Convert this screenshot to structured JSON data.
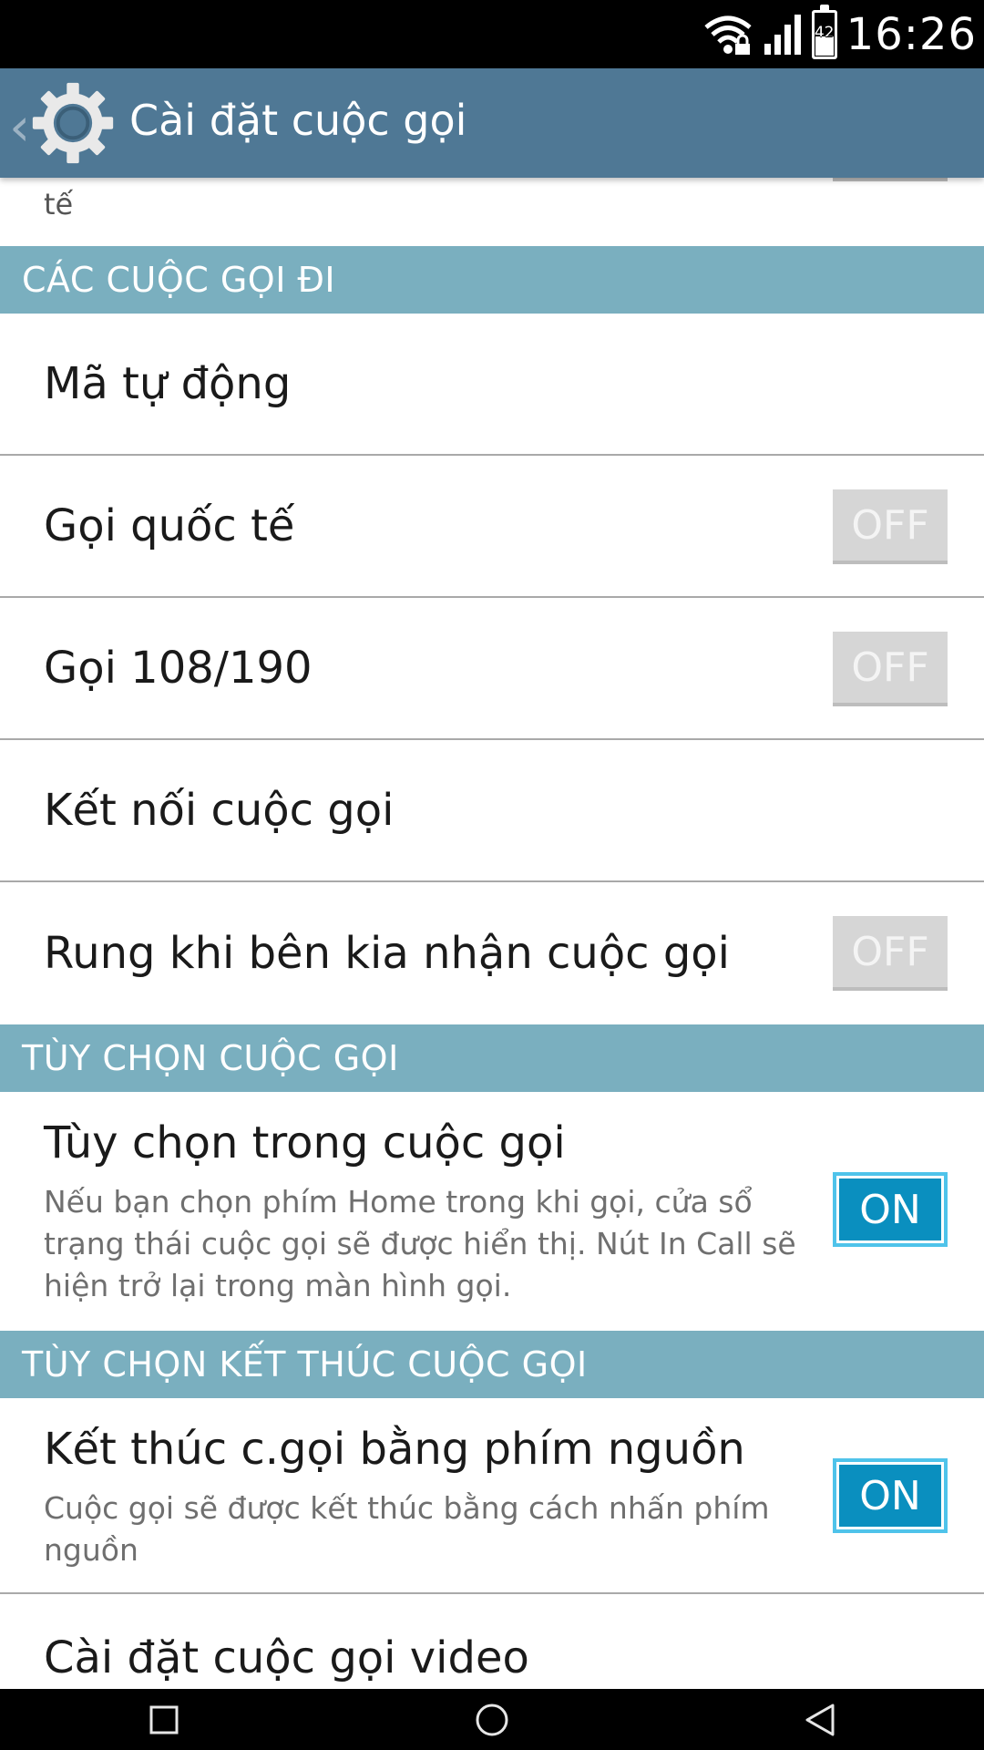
{
  "status_bar": {
    "time": "16:26",
    "battery_level": "42",
    "battery_fraction": 0.42,
    "icons": [
      "wifi-icon",
      "signal-icon",
      "battery-icon"
    ]
  },
  "action_bar": {
    "title": "Cài đặt cuộc gọi",
    "back_icon": "chevron-left-icon",
    "app_icon": "gear-icon"
  },
  "partial_item": {
    "text": "tế"
  },
  "sections": {
    "outgoing": {
      "header": "CÁC CUỘC GỌI ĐI",
      "items": [
        {
          "label": "Mã tự động"
        },
        {
          "label": "Gọi quốc tế",
          "toggle": "OFF"
        },
        {
          "label": "Gọi 108/190",
          "toggle": "OFF"
        },
        {
          "label": "Kết nối cuộc gọi"
        },
        {
          "label": "Rung khi bên kia nhận cuộc gọi",
          "toggle": "OFF"
        }
      ]
    },
    "call_options": {
      "header": "TÙY CHỌN CUỘC GỌI",
      "items": [
        {
          "label": "Tùy chọn trong cuộc gọi",
          "summary": "Nếu bạn chọn phím Home trong khi gọi, cửa sổ trạng thái cuộc gọi sẽ được hiển thị. Nút In Call sẽ hiện trở lại trong màn hình gọi.",
          "toggle": "ON"
        }
      ]
    },
    "end_call": {
      "header": "TÙY CHỌN KẾT THÚC CUỘC GỌI",
      "items": [
        {
          "label": "Kết thúc c.gọi bằng phím nguồn",
          "summary": "Cuộc gọi sẽ được kết thúc bằng cách nhấn phím nguồn",
          "toggle": "ON"
        },
        {
          "label": "Cài đặt cuộc gọi video"
        }
      ]
    }
  },
  "nav_bar": {
    "buttons": [
      "recents-icon",
      "home-icon",
      "back-icon"
    ]
  },
  "colors": {
    "action_bar": "#4f7895",
    "section_header": "#7aafbf",
    "toggle_on": "#0a8fbf",
    "toggle_off": "#d6d6d6"
  }
}
